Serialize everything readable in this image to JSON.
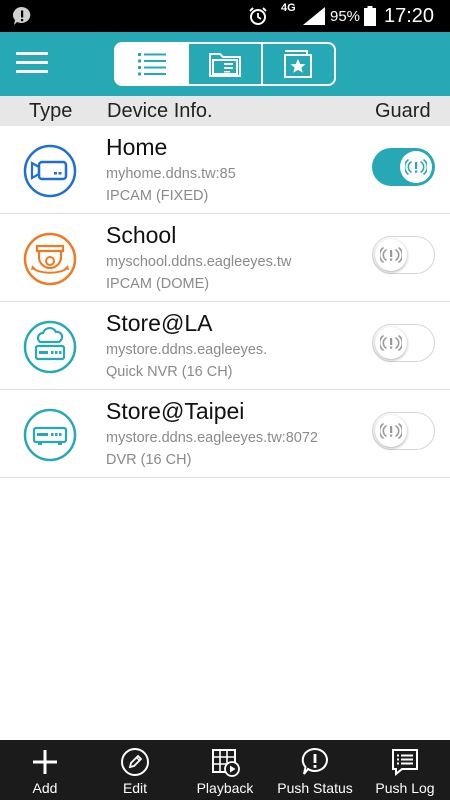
{
  "status_bar": {
    "network": "4G",
    "battery": "95%",
    "time": "17:20"
  },
  "app_bar": {
    "tabs": [
      {
        "icon": "list-icon",
        "active": true
      },
      {
        "icon": "folder-icon",
        "active": false
      },
      {
        "icon": "favorites-icon",
        "active": false
      }
    ]
  },
  "header": {
    "type": "Type",
    "info": "Device Info.",
    "guard": "Guard"
  },
  "devices": [
    {
      "name": "Home",
      "host": "myhome.ddns.tw:85",
      "type": "IPCAM (FIXED)",
      "icon": "ipcam-fixed-icon",
      "icon_color": "#1e6fd0",
      "guard": true
    },
    {
      "name": "School",
      "host": "myschool.ddns.eagleeyes.tw",
      "type": "IPCAM (DOME)",
      "icon": "ipcam-dome-icon",
      "icon_color": "#f07a22",
      "guard": false
    },
    {
      "name": "Store@LA",
      "host": "mystore.ddns.eagleeyes.",
      "type": "Quick NVR (16 CH)",
      "icon": "cloud-nvr-icon",
      "icon_color": "#26a9b5",
      "guard": false
    },
    {
      "name": "Store@Taipei",
      "host": "mystore.ddns.eagleeyes.tw:8072",
      "type": "DVR (16 CH)",
      "icon": "dvr-icon",
      "icon_color": "#26a9b5",
      "guard": false
    }
  ],
  "bottom_bar": {
    "add": "Add",
    "edit": "Edit",
    "playback": "Playback",
    "push_status": "Push Status",
    "push_log": "Push Log"
  },
  "colors": {
    "accent": "#26a9b5",
    "home_icon": "#1e6fd0",
    "school_icon": "#f07a22",
    "bottom_bar": "#1b1b1b"
  }
}
